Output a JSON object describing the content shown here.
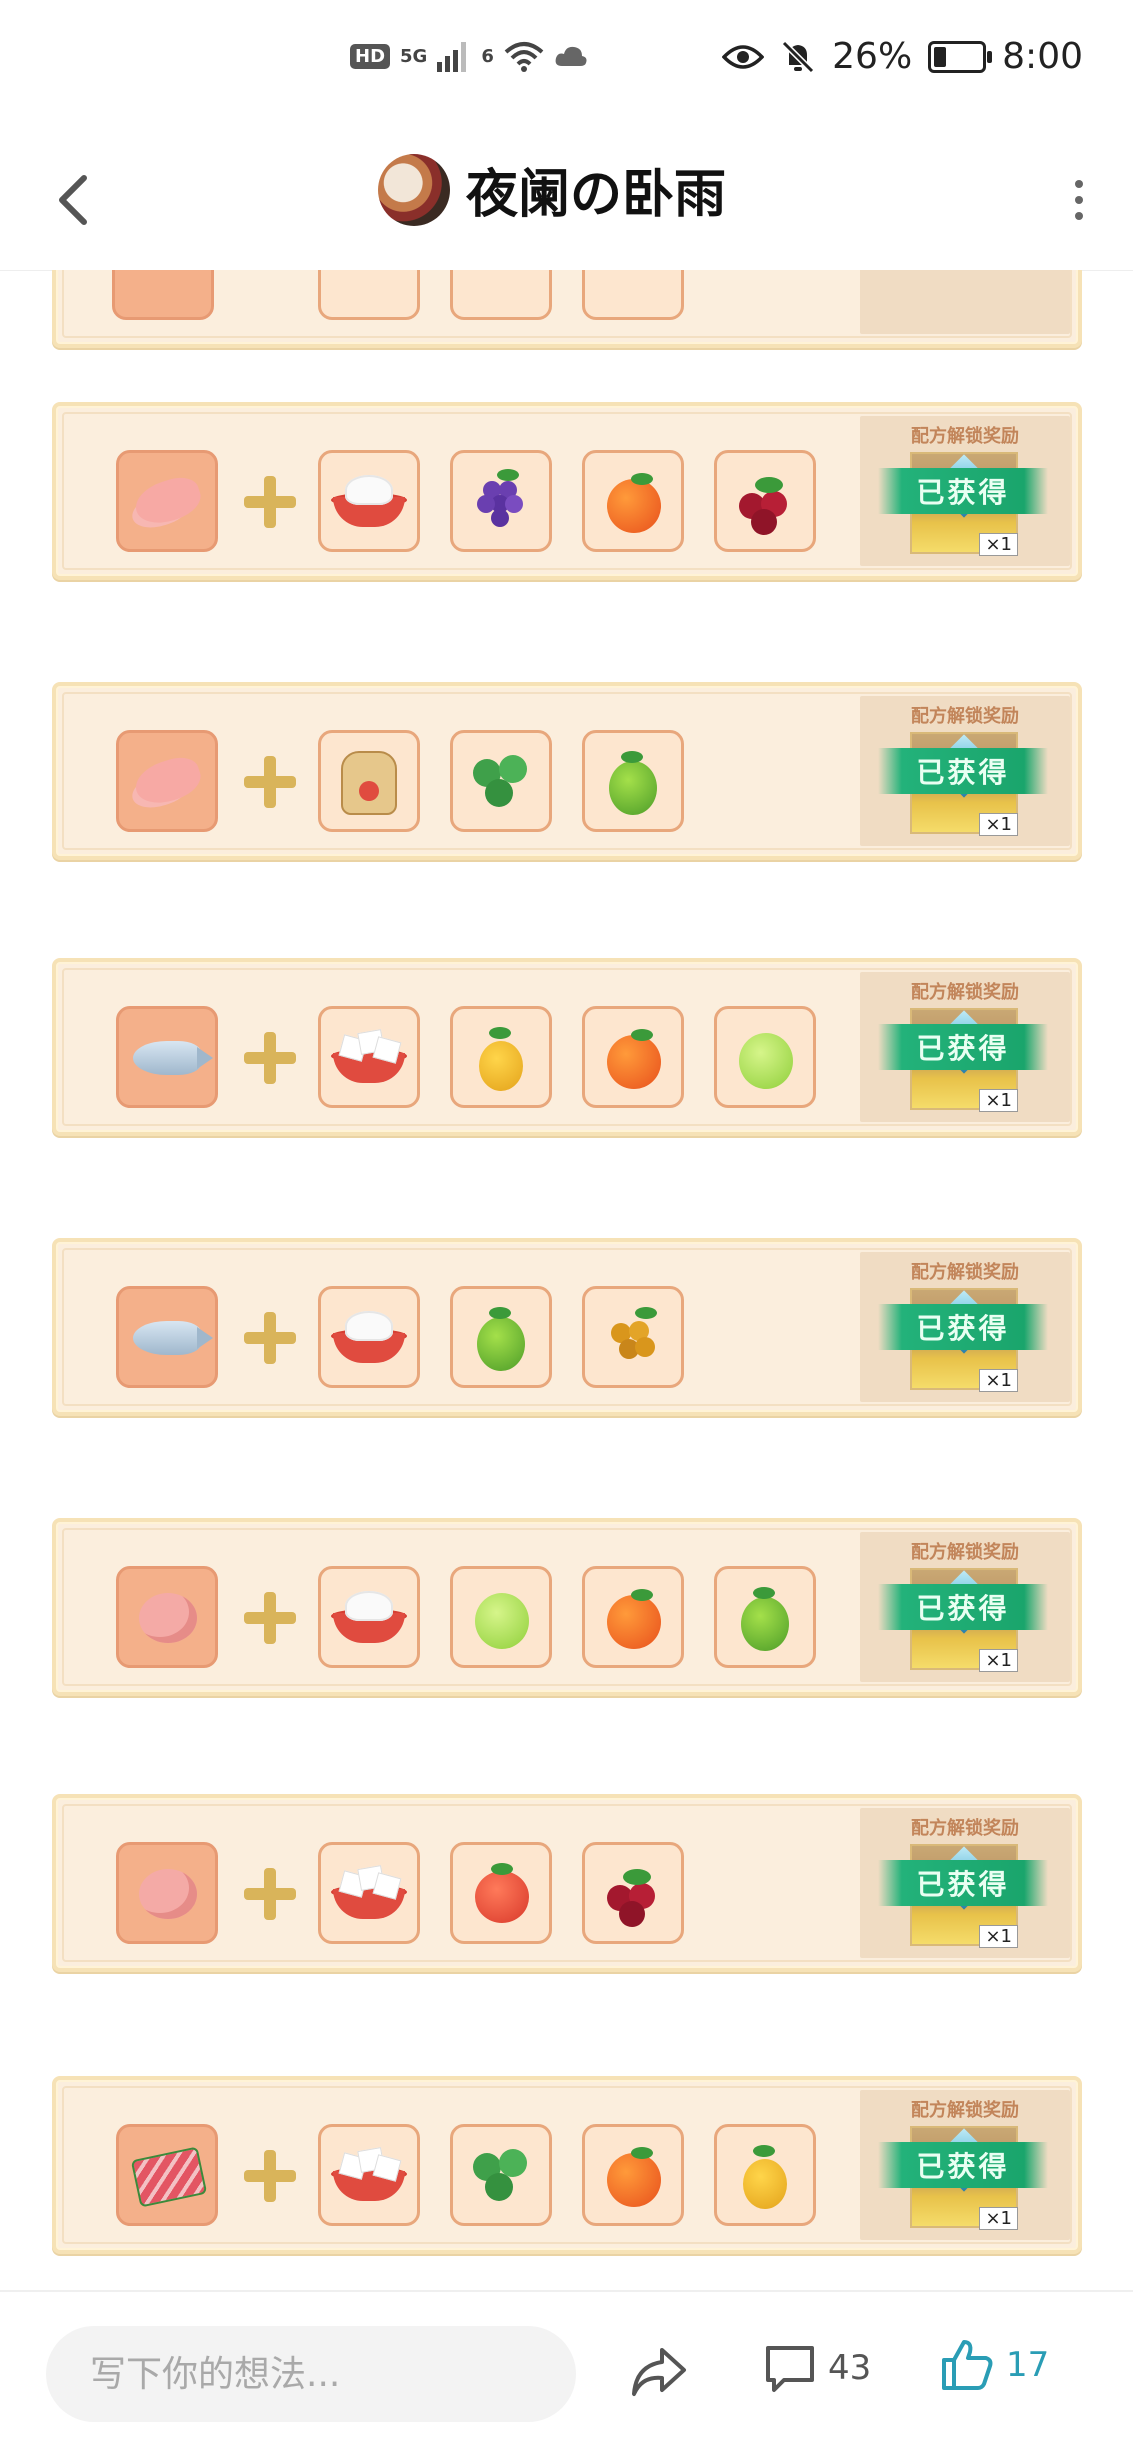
{
  "status_bar": {
    "hd": "HD",
    "network": "5G",
    "wifi_gen": "6",
    "battery": "26%",
    "time": "8:00",
    "battery_level": 0.26
  },
  "header": {
    "title": "夜阑の卧雨"
  },
  "recipes": {
    "reward_label": "配方解锁奖励",
    "stamp": "已获得",
    "qty": "×1"
  },
  "comment_bar": {
    "placeholder": "写下你的想法...",
    "comment_count": "43",
    "like_count": "17"
  },
  "icons": [
    "back-arrow-icon",
    "more-vert-icon",
    "eye-icon",
    "mute-bell-icon",
    "wifi-icon",
    "cloud-icon",
    "share-icon",
    "comment-icon",
    "thumbs-up-icon"
  ],
  "colors": {
    "card_bg": "#fbeedd",
    "tile_border": "#e8a77c",
    "plus": "#d9b45a",
    "stamp_green": "#1aa56c",
    "like_blue": "#2a9db5"
  }
}
